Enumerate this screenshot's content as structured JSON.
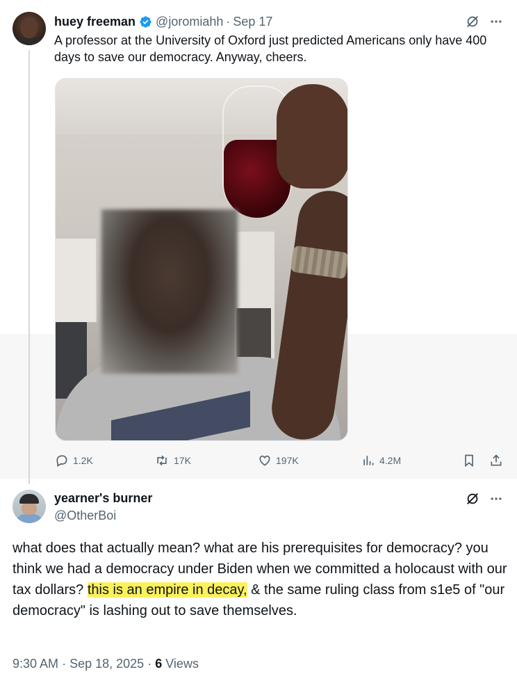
{
  "tweet1": {
    "display_name": "huey freeman",
    "handle": "@joromiahh",
    "separator": "·",
    "date": "Sep 17",
    "text": "A professor at the University of Oxford just predicted Americans only have 400 days to save our democracy. Anyway, cheers.",
    "actions": {
      "replies": "1.2K",
      "retweets": "17K",
      "likes": "197K",
      "views": "4.2M"
    }
  },
  "tweet2": {
    "display_name": "yearner's burner",
    "handle": "@OtherBoi",
    "text_before": "what does that actually mean? what are his prerequisites for democracy? you think we had a democracy under Biden when we committed a holocaust with our tax dollars? ",
    "text_highlight": "this is an empire in decay,",
    "text_after": " & the same ruling class from s1e5 of \"our democracy\" is lashing out to save themselves.",
    "time": "9:30 AM",
    "meta_separator": "·",
    "date": "Sep 18, 2025",
    "views_count": "6",
    "views_label": "Views"
  },
  "icons": {
    "verified": "verified-badge-icon",
    "grok": "grok-icon",
    "more": "more-icon",
    "reply": "reply-icon",
    "retweet": "retweet-icon",
    "like": "heart-icon",
    "views": "views-icon",
    "bookmark": "bookmark-icon",
    "share": "share-icon"
  },
  "colors": {
    "text_primary": "#0f1419",
    "text_secondary": "#536471",
    "verified_blue": "#1d9bf0",
    "highlight": "#fbf15b"
  }
}
